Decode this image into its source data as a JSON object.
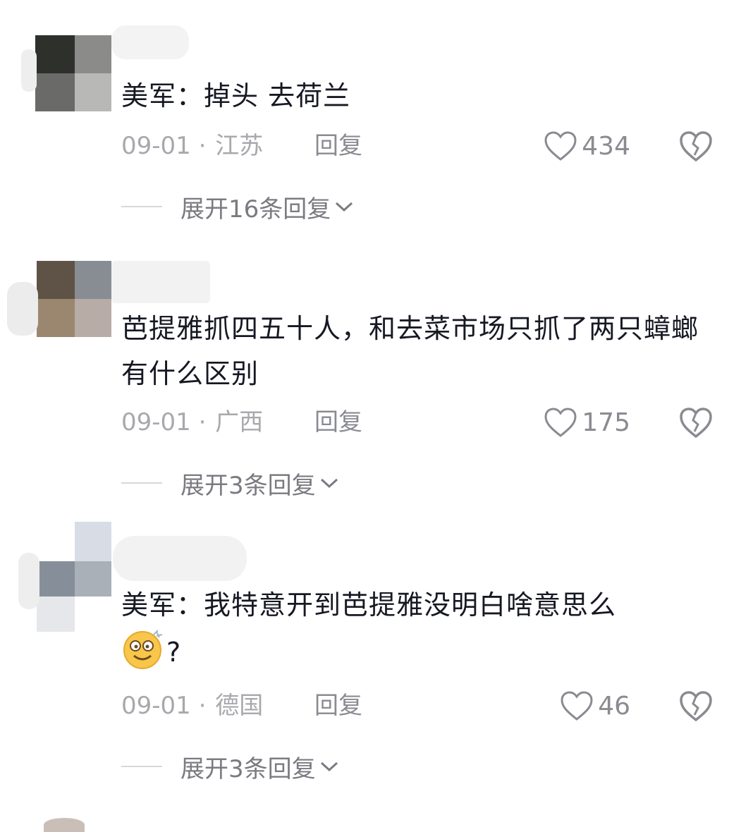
{
  "comments": [
    {
      "text": "美军：掉头 去荷兰",
      "date": "09-01",
      "separator": "·",
      "location": "江苏",
      "reply_label": "回复",
      "likes": "434",
      "expand_label": "展开16条回复"
    },
    {
      "text": "芭提雅抓四五十人，和去菜市场只抓了两只蟑螂有什么区别",
      "date": "09-01",
      "separator": "·",
      "location": "广西",
      "reply_label": "回复",
      "likes": "175",
      "expand_label": "展开3条回复"
    },
    {
      "text": "美军：我特意开到芭提雅没明白啥意思么",
      "text_suffix": "?",
      "emoji": "dizzy-smile-emoji",
      "date": "09-01",
      "separator": "·",
      "location": "德国",
      "reply_label": "回复",
      "likes": "46",
      "expand_label": "展开3条回复"
    }
  ],
  "icons": {
    "like": "heart-outline-icon",
    "dislike": "broken-heart-icon",
    "expand": "chevron-down-icon"
  },
  "colors": {
    "text": "#161823",
    "meta": "#a8a8ad",
    "action": "#8a8b91"
  }
}
